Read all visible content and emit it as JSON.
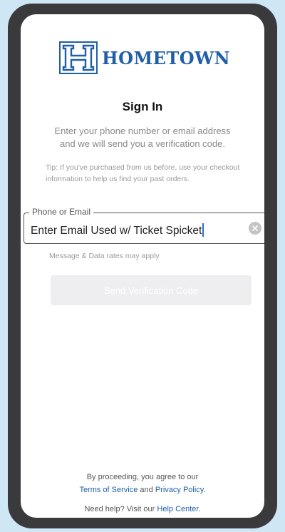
{
  "brand": {
    "name": "HOMETOWN",
    "logo_icon": "hometown-h-logo-icon",
    "color": "#1f5fa8"
  },
  "signin": {
    "title": "Sign In",
    "subtitle": "Enter your phone number or email address and we will send you a verification code.",
    "tip": "Tip: If you've purchased from us before, use your checkout information to help us find your past orders."
  },
  "field": {
    "label": "Phone or Email",
    "value": "Enter Email Used w/ Ticket Spicket",
    "clear_icon": "clear-x-icon"
  },
  "rates_note": "Message & Data rates may apply.",
  "send_button": {
    "label": "Send Verification Code",
    "enabled": false
  },
  "legal": {
    "prefix": "By proceeding, you agree to our",
    "terms": "Terms of Service",
    "and": "and",
    "privacy": "Privacy Policy",
    "period": "."
  },
  "help": {
    "prefix": "Need help? Visit our",
    "link": "Help Center",
    "period": "."
  }
}
